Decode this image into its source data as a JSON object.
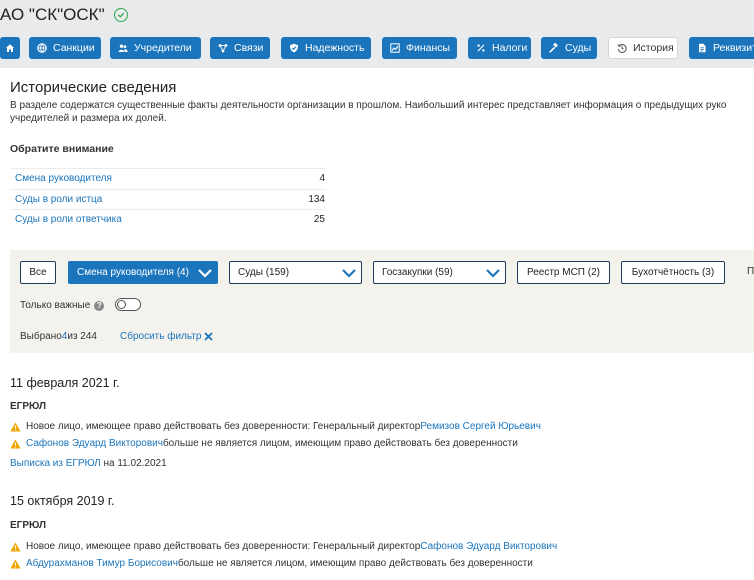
{
  "company": {
    "name": "АО \"СК\"ОСК\""
  },
  "tabs": [
    {
      "label": "",
      "icon": "home-icon"
    },
    {
      "label": "Санкции",
      "icon": "globe-icon"
    },
    {
      "label": "Учредители",
      "icon": "users-icon"
    },
    {
      "label": "Связи",
      "icon": "network-icon"
    },
    {
      "label": "Надежность",
      "icon": "shield-icon"
    },
    {
      "label": "Финансы",
      "icon": "chart-icon"
    },
    {
      "label": "Налоги",
      "icon": "percent-icon"
    },
    {
      "label": "Суды",
      "icon": "gavel-icon"
    },
    {
      "label": "История",
      "icon": "history-icon",
      "active": true
    },
    {
      "label": "Реквизиты",
      "icon": "document-icon"
    }
  ],
  "section": {
    "title": "Исторические сведения",
    "description_line1": "В разделе содержатся существенные факты деятельности организации в прошлом. Наибольший интерес представляет информация о предыдущих руко",
    "description_line2": "учредителей и размера их долей."
  },
  "attention": {
    "title": "Обратите внимание",
    "rows": [
      {
        "label": "Смена руководителя",
        "count": "4"
      },
      {
        "label": "Суды в роли истца",
        "count": "134"
      },
      {
        "label": "Суды в роли ответчика",
        "count": "25"
      }
    ]
  },
  "filters": {
    "all": "Все",
    "manager_change": "Смена руководителя (4)",
    "courts": "Суды (159)",
    "procurement": "Госзакупки (59)",
    "msp": "Реестр МСП (2)",
    "accounting": "Бухотчётность (3)",
    "more": "П",
    "important_only": "Только важные",
    "help": "?",
    "selected_prefix": "Выбрано ",
    "selected_count": "4",
    "selected_suffix": " из 244",
    "reset": "Сбросить фильтр"
  },
  "events": [
    {
      "date": "11 февраля 2021 г.",
      "source": "ЕГРЮЛ",
      "items": [
        {
          "text": "Новое лицо, имеющее право действовать без доверенности: Генеральный директор ",
          "link": "Ремизов Сергей Юрьевич"
        },
        {
          "link": "Сафонов Эдуард Викторович",
          "text": " больше не является лицом, имеющим право действовать без доверенности"
        }
      ],
      "extract_link": "Выписка из ЕГРЮЛ",
      "extract_suffix": " на 11.02.2021"
    },
    {
      "date": "15 октября 2019 г.",
      "source": "ЕГРЮЛ",
      "items": [
        {
          "text": "Новое лицо, имеющее право действовать без доверенности: Генеральный директор ",
          "link": "Сафонов Эдуард Викторович"
        },
        {
          "link": "Абдурахманов Тимур Борисович",
          "text": " больше не является лицом, имеющим право действовать без доверенности"
        }
      ]
    }
  ],
  "colors": {
    "accent": "#1b75bc",
    "check": "#2fa84f",
    "warning": "#f0a500",
    "panel": "#f3f2ec"
  }
}
